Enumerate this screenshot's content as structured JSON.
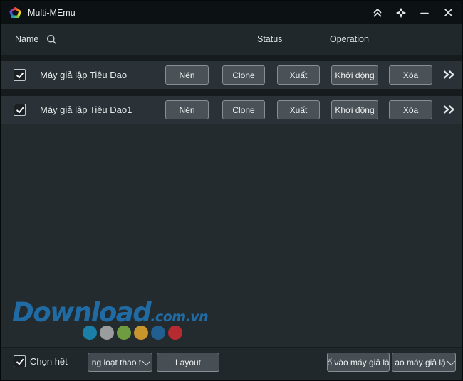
{
  "titlebar": {
    "title": "Multi-MEmu",
    "logo_icon": "memu-pentagon-logo",
    "control_icons": [
      "double-chevron-up",
      "gear",
      "minimize",
      "close"
    ]
  },
  "header": {
    "name_label": "Name",
    "search_icon": "magnifier",
    "status_label": "Status",
    "operation_label": "Operation"
  },
  "rows": [
    {
      "checked": true,
      "name": "Máy giả lập Tiêu Dao",
      "buttons": {
        "compress": "Nén",
        "clone": "Clone",
        "export": "Xuất",
        "start": "Khởi động",
        "delete": "Xóa"
      },
      "more_icon": "double-chevron-right"
    },
    {
      "checked": true,
      "name": "Máy giả lập Tiêu Dao1",
      "buttons": {
        "compress": "Nén",
        "clone": "Clone",
        "export": "Xuất",
        "start": "Khởi động",
        "delete": "Xóa"
      },
      "more_icon": "double-chevron-right"
    }
  ],
  "watermark": {
    "brand": "Download",
    "suffix": ".com.vn",
    "brand_color": "#2173b2",
    "dot_colors": [
      "#1b80a7",
      "#9a9c9d",
      "#6f9c40",
      "#c8942c",
      "#215f90",
      "#b52b31"
    ]
  },
  "footer": {
    "select_all_label": "Chọn hết",
    "batch_dropdown_value": "ng loạt thao t",
    "layout_button": "Layout",
    "import_button": "ố vào máy giả lậ",
    "create_button": "ạo máy giả lậ"
  }
}
